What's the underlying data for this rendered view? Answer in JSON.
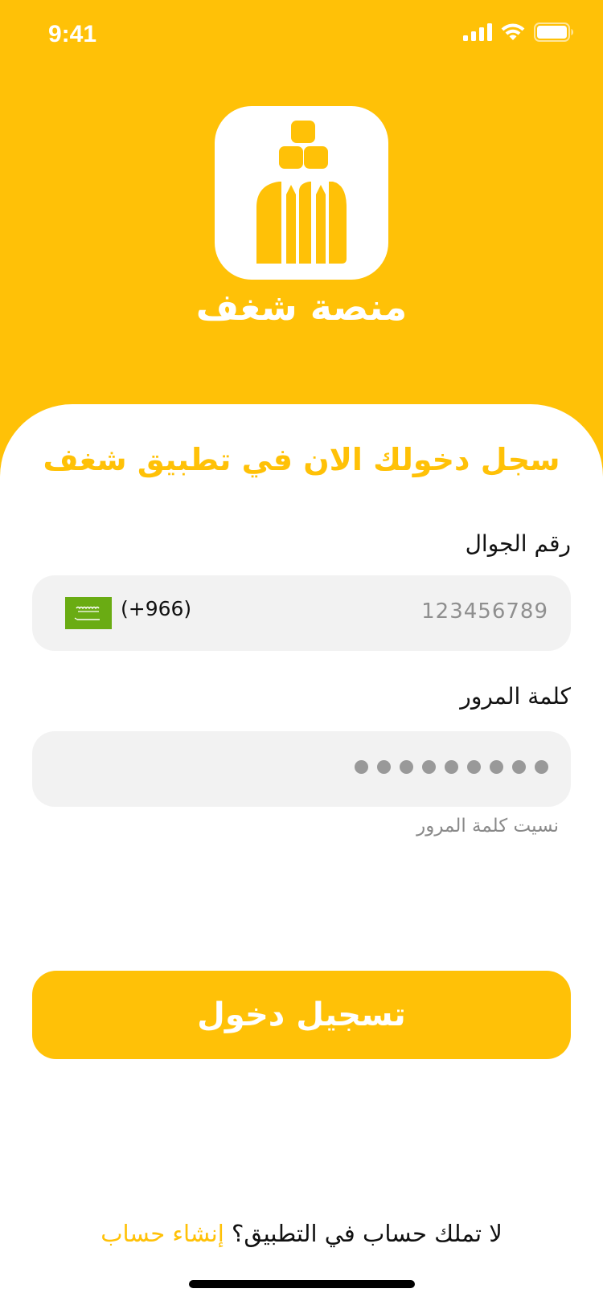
{
  "status_bar": {
    "time": "9:41"
  },
  "app": {
    "name": "منصة شغف"
  },
  "login": {
    "title": "سجل دخولك الان في تطبيق شغف",
    "phone_label": "رقم الجوال",
    "phone_placeholder": "123456789",
    "country_code": "(+966)",
    "password_label": "كلمة المرور",
    "password_mask_length": 9,
    "forgot_password": "نسيت كلمة المرور",
    "submit_label": "تسجيل دخول"
  },
  "signup": {
    "prompt": "لا تملك حساب في التطبيق؟",
    "link": "إنشاء حساب"
  },
  "colors": {
    "brand": "#ffc107",
    "flag_green": "#6aac13",
    "input_bg": "#f2f2f2"
  },
  "icons": [
    "signal-icon",
    "wifi-icon",
    "battery-icon",
    "app-logo-icon",
    "saudi-flag-icon"
  ]
}
